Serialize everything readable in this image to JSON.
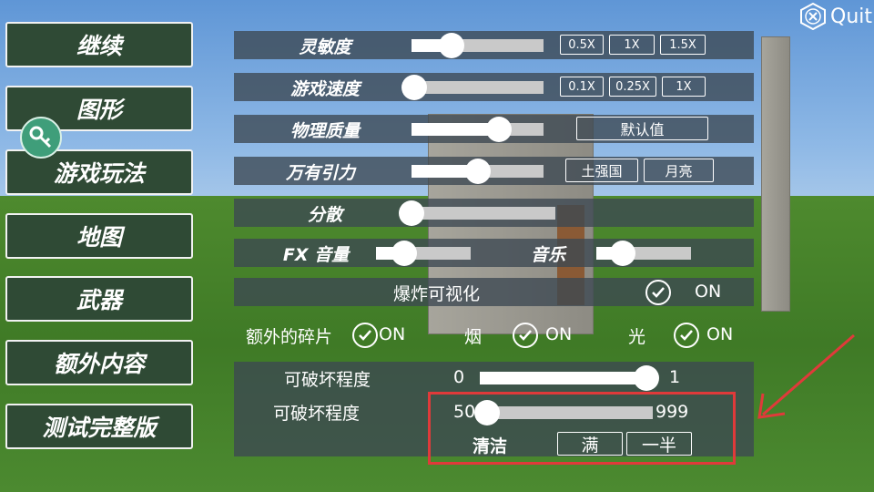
{
  "sidebar": {
    "items": [
      {
        "label": "继续"
      },
      {
        "label": "图形"
      },
      {
        "label": "游戏玩法"
      },
      {
        "label": "地图"
      },
      {
        "label": "武器"
      },
      {
        "label": "额外内容"
      },
      {
        "label": "测试完整版"
      }
    ]
  },
  "quit": {
    "label": "Quit"
  },
  "settings": {
    "sensitivity": {
      "label": "灵敏度",
      "value": 0.3,
      "options": [
        "0.5X",
        "1X",
        "1.5X"
      ]
    },
    "game_speed": {
      "label": "游戏速度",
      "value": 0.0,
      "options": [
        "0.1X",
        "0.25X",
        "1X"
      ]
    },
    "physics_quality": {
      "label": "物理质量",
      "value": 0.66,
      "default_label": "默认值"
    },
    "gravity": {
      "label": "万有引力",
      "value": 0.5,
      "options": [
        "土强国",
        "月亮"
      ]
    },
    "scatter": {
      "label": "分散",
      "value": 0.0
    },
    "fx_volume": {
      "label": "FX 音量",
      "value": 0.3
    },
    "music": {
      "label": "音乐",
      "value": 0.28
    },
    "explosion_visual": {
      "label": "爆炸可视化",
      "state": "ON"
    },
    "extra_debris": {
      "label": "额外的碎片",
      "state": "ON"
    },
    "smoke": {
      "label": "烟",
      "state": "ON"
    },
    "light": {
      "label": "光",
      "state": "ON"
    },
    "destruction1": {
      "label": "可破坏程度",
      "min": "0",
      "max": "1",
      "value": 1.0
    },
    "destruction2": {
      "label": "可破坏程度",
      "min": "50",
      "max": "999",
      "value": 0.04
    },
    "cleanup": {
      "label": "清洁",
      "full_label": "满",
      "half_label": "一半"
    }
  },
  "colors": {
    "highlight": "#e03a3a",
    "panel": "#3c4852",
    "side_button": "#2f4a35"
  }
}
